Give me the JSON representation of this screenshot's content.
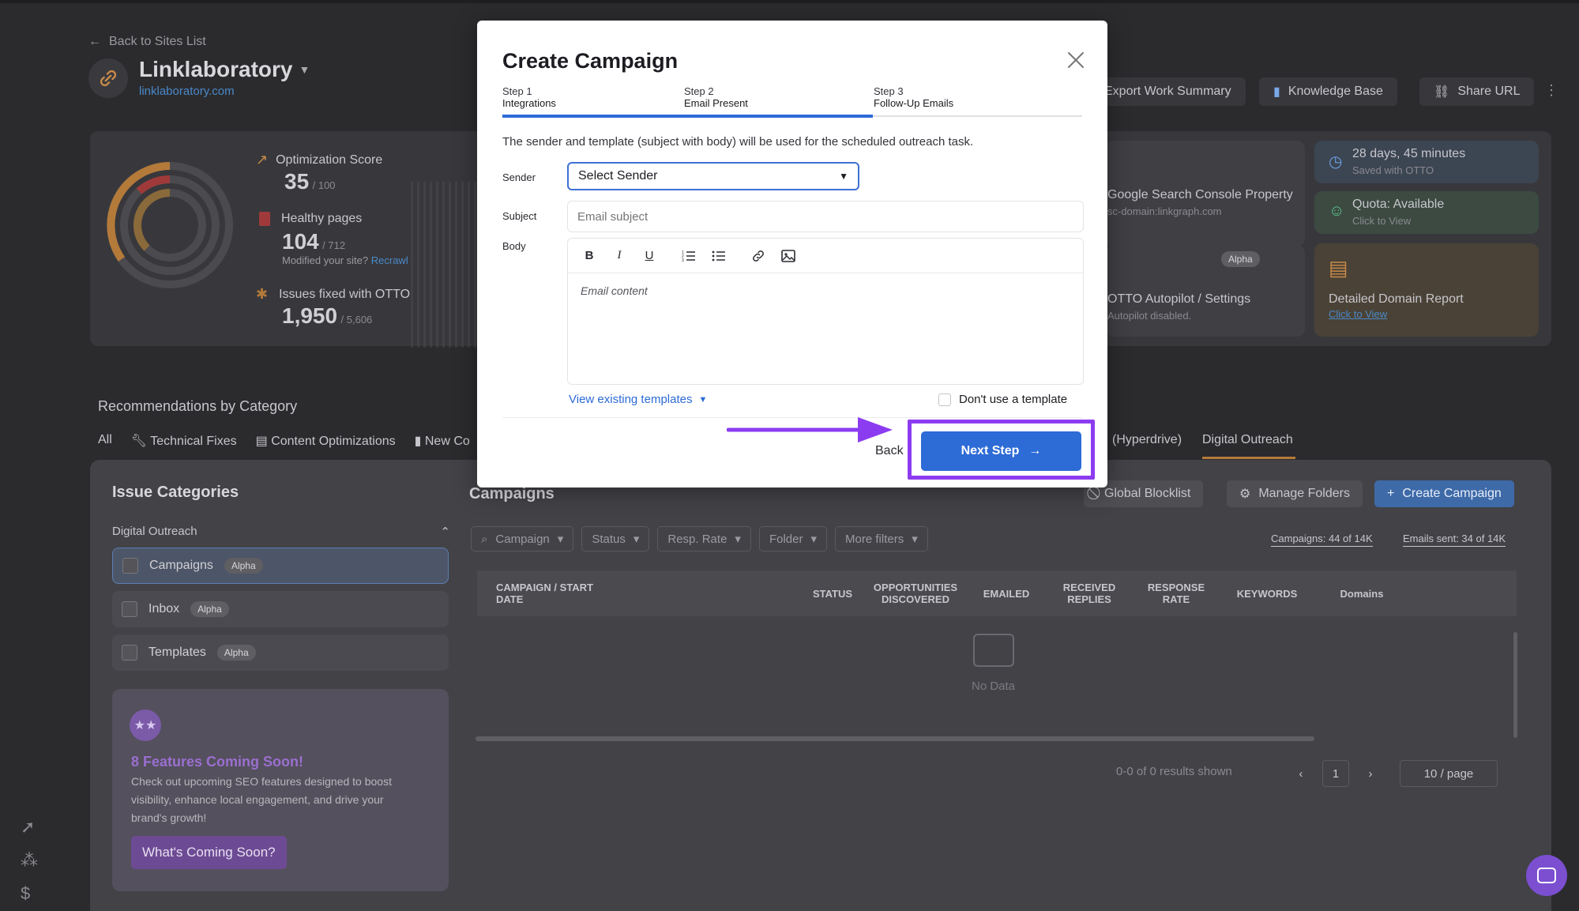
{
  "background": {
    "back_link": "Back to Sites List",
    "site_title": "Linklaboratory",
    "site_url": "linklaboratory.com",
    "top_buttons": {
      "export": "Export Work Summary",
      "knowledge": "Knowledge Base",
      "share": "Share URL"
    },
    "metrics": {
      "optimization_label": "Optimization Score",
      "optimization_value": "35",
      "optimization_total": "/ 100",
      "healthy_label": "Healthy pages",
      "healthy_value": "104",
      "healthy_total": "/ 712",
      "modified_text": "Modified your site?",
      "recrawl": "Recrawl",
      "issues_label": "Issues fixed with OTTO",
      "issues_value": "1,950",
      "issues_total": "/ 5,606"
    },
    "cards": {
      "gsc_title": "Google Search Console Property",
      "gsc_sub": "sc-domain:linkgraph.com",
      "autopilot_title": "OTTO Autopilot / Settings",
      "autopilot_sub": "Autopilot disabled.",
      "autopilot_badge": "Alpha",
      "time_title": "28 days, 45 minutes",
      "time_sub": "Saved with OTTO",
      "quota_title": "Quota: Available",
      "quota_sub": "Click to View",
      "domain_title": "Detailed Domain Report",
      "domain_sub": "Click to View"
    },
    "recommendations_title": "Recommendations by Category",
    "tabs": [
      "All",
      "Technical Fixes",
      "Content Optimizations",
      "New Co"
    ],
    "tab_hyperdrive": "(Hyperdrive)",
    "tab_outreach": "Digital Outreach",
    "issue_categories": "Issue Categories",
    "category_group": "Digital Outreach",
    "category_items": [
      {
        "label": "Campaigns",
        "badge": "Alpha"
      },
      {
        "label": "Inbox",
        "badge": "Alpha"
      },
      {
        "label": "Templates",
        "badge": "Alpha"
      }
    ],
    "features": {
      "title": "8 Features Coming Soon!",
      "text": "Check out upcoming SEO features designed to boost visibility, enhance local engagement, and drive your brand's growth!",
      "button": "What's Coming Soon?"
    },
    "campaigns": {
      "title": "Campaigns",
      "global_blocklist": "Global Blocklist",
      "manage_folders": "Manage Folders",
      "create_campaign": "Create Campaign",
      "filters": [
        "Campaign",
        "Status",
        "Resp. Rate",
        "Folder",
        "More filters"
      ],
      "campaigns_count": "Campaigns: 44 of 14K",
      "emails_count": "Emails sent: 34 of 14K",
      "columns": [
        "CAMPAIGN / START DATE",
        "STATUS",
        "OPPORTUNITIES DISCOVERED",
        "EMAILED",
        "RECEIVED REPLIES",
        "RESPONSE RATE",
        "KEYWORDS",
        "Domains"
      ],
      "no_data": "No Data",
      "results": "0-0 of 0 results shown",
      "page": "1",
      "per_page": "10 / page"
    }
  },
  "modal": {
    "title": "Create Campaign",
    "steps": [
      {
        "step": "Step 1",
        "name": "Integrations"
      },
      {
        "step": "Step 2",
        "name": "Email Present"
      },
      {
        "step": "Step 3",
        "name": "Follow-Up Emails"
      }
    ],
    "description": "The sender and template (subject with body) will be used for the scheduled outreach task.",
    "sender_label": "Sender",
    "sender_value": "Select Sender",
    "subject_label": "Subject",
    "subject_placeholder": "Email subject",
    "body_label": "Body",
    "body_placeholder": "Email content",
    "templates_link": "View existing templates",
    "no_template": "Don't use a template",
    "back": "Back",
    "next": "Next Step"
  },
  "colors": {
    "primary": "#2d6bd6",
    "highlight": "#8c3cf0",
    "background": "#2b2b2e"
  }
}
